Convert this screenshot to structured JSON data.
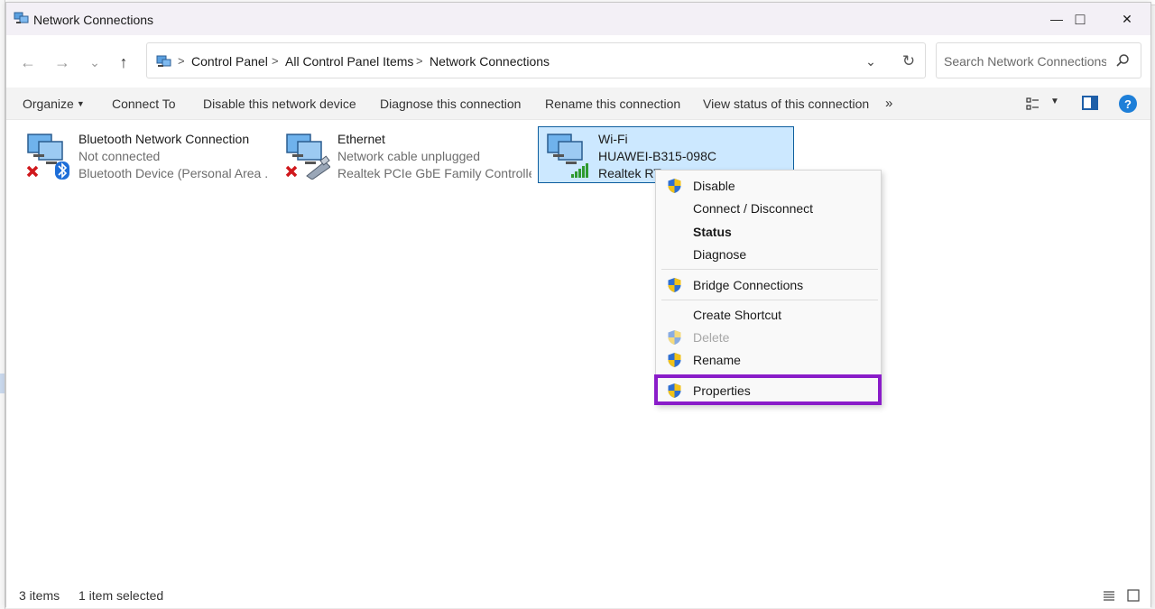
{
  "window": {
    "title": "Network Connections",
    "minimize_glyph": "—",
    "maximize_glyph": "□",
    "close_glyph": "✕"
  },
  "nav": {
    "back_glyph": "←",
    "forward_glyph": "→",
    "recent_glyph": "⌄",
    "up_glyph": "↑"
  },
  "breadcrumb": {
    "items": [
      "Control Panel",
      "All Control Panel Items",
      "Network Connections"
    ],
    "sep": ">",
    "dropdown_glyph": "⌄",
    "refresh_glyph": "↻"
  },
  "search": {
    "placeholder": "Search Network Connections"
  },
  "commands": {
    "organize": "Organize",
    "organize_caret": "▼",
    "connect_to": "Connect To",
    "disable_device": "Disable this network device",
    "diagnose": "Diagnose this connection",
    "rename": "Rename this connection",
    "view_status": "View status of this connection",
    "more": "»",
    "view_caret": "▼",
    "help": "?"
  },
  "connections": [
    {
      "name": "Bluetooth Network Connection",
      "status": "Not connected",
      "device": "Bluetooth Device (Personal Area ..."
    },
    {
      "name": "Ethernet",
      "status": "Network cable unplugged",
      "device": "Realtek PCIe GbE Family Controller"
    },
    {
      "name": "Wi-Fi",
      "status": "HUAWEI-B315-098C",
      "device": "Realtek RT"
    }
  ],
  "context_menu": {
    "disable": "Disable",
    "connect_disconnect": "Connect / Disconnect",
    "status": "Status",
    "diagnose": "Diagnose",
    "bridge": "Bridge Connections",
    "shortcut": "Create Shortcut",
    "delete": "Delete",
    "rename": "Rename",
    "properties": "Properties"
  },
  "statusbar": {
    "items_count": "3 items",
    "selected": "1 item selected"
  },
  "colors": {
    "highlight": "#8a1cc9",
    "selection": "#cce8ff",
    "selection_border": "#0c5d9e",
    "accent": "#1e7fd8"
  }
}
